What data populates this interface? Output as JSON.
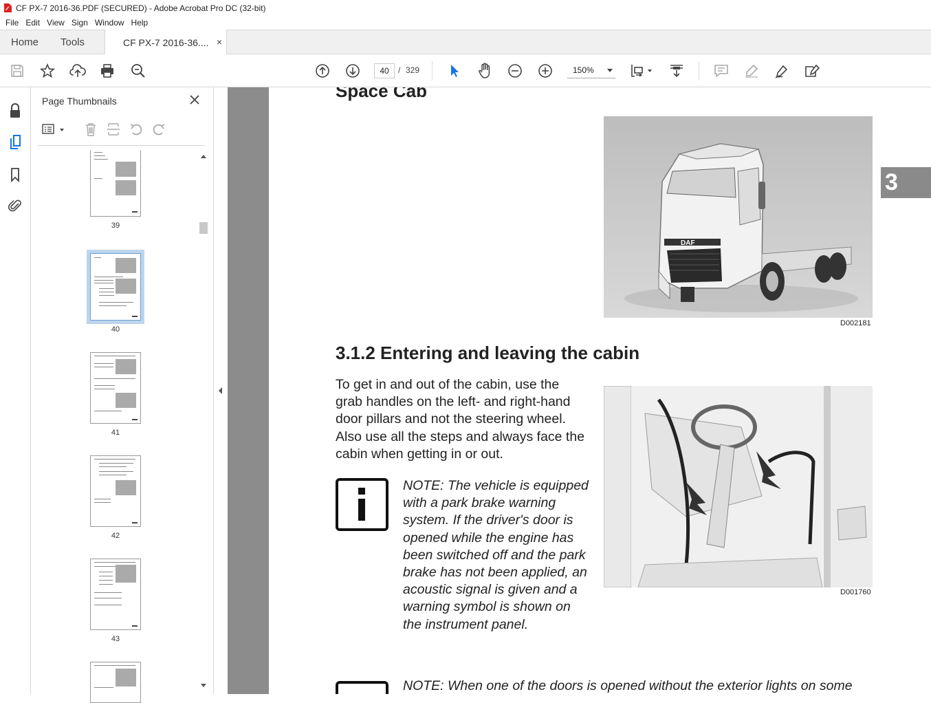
{
  "window": {
    "title": "CF PX-7  2016-36.PDF (SECURED) - Adobe Acrobat Pro DC (32-bit)"
  },
  "menu": [
    "File",
    "Edit",
    "View",
    "Sign",
    "Window",
    "Help"
  ],
  "tabs": {
    "home": "Home",
    "tools": "Tools",
    "document": "CF PX-7  2016-36....",
    "close": "×"
  },
  "toolbar": {
    "page_current": "40",
    "page_sep": "/",
    "page_total": "329",
    "zoom": "150%"
  },
  "thumbnails_panel": {
    "title": "Page Thumbnails",
    "pages": [
      {
        "number": "39",
        "selected": false
      },
      {
        "number": "40",
        "selected": true
      },
      {
        "number": "41",
        "selected": false
      },
      {
        "number": "42",
        "selected": false
      },
      {
        "number": "43",
        "selected": false
      }
    ]
  },
  "document": {
    "heading_space_cab": "Space Cab",
    "chapter_tab": "3",
    "figure1_code": "D002181",
    "heading_section": "3.1.2 Entering and leaving the cabin",
    "body_paragraph": "To get in and out of the cabin, use the grab handles on the left- and right-hand door pillars and not the steering wheel. Also use all the steps and always face the cabin when getting in or out.",
    "note1": "NOTE:  The vehicle is equipped with a park brake warning system. If the driver's door is opened while the engine has been switched off and the park brake has not been applied, an acoustic signal is given and a warning symbol is shown on the instrument panel.",
    "note2": "NOTE:  When one of the doors is opened without the exterior lights on some",
    "figure2_code": "D001760",
    "logo_text": "DAF"
  },
  "colors": {
    "doc_background": "#8c8c8c",
    "chapter_tab": "#8a8a8a",
    "selected_thumb": "#bcd5ec",
    "select_tool": "#1473e6"
  }
}
